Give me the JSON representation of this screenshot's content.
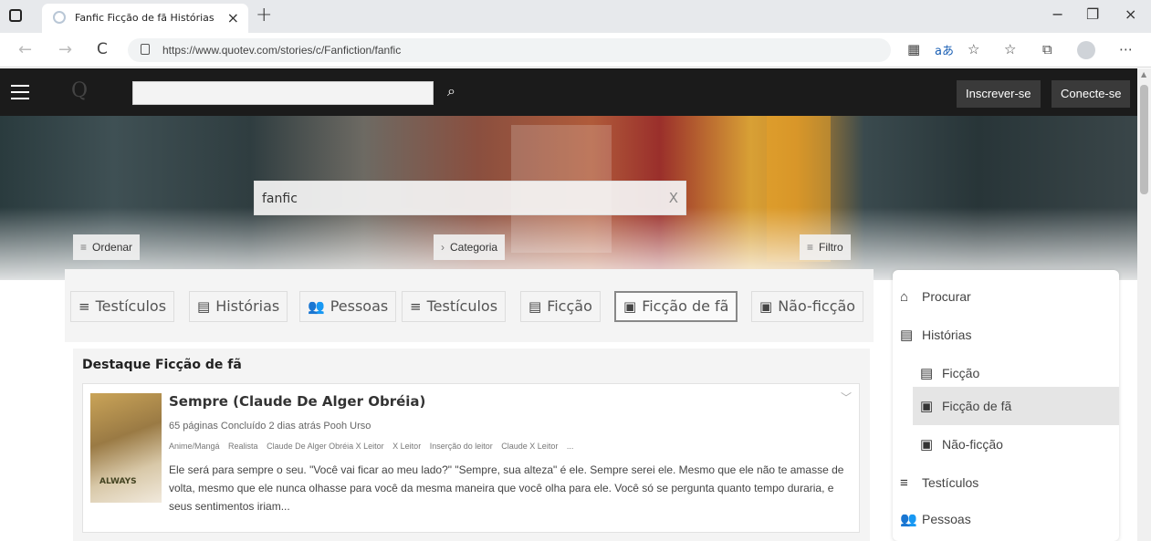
{
  "browser": {
    "tab_title": "Fanfic Ficção de fã Histórias",
    "tab_close": "×",
    "new_tab": "+",
    "url": "https://www.quotev.com/stories/c/Fanfiction/fanfic",
    "window_controls": {
      "minimize": "−",
      "restore": "❐",
      "close": "×"
    },
    "nav": {
      "back": "←",
      "forward": "→",
      "refresh": "C"
    }
  },
  "site": {
    "logo": "Q",
    "search_placeholder": "",
    "search_glyph": "⌕",
    "signup_label": "Inscrever-se",
    "login_label": "Conecte-se"
  },
  "hero": {
    "query": "fanfic",
    "clear": "X",
    "sort_label": "Ordenar",
    "category_label": "Categoria",
    "filter_label": "Filtro"
  },
  "tabs": [
    {
      "label": "Testículos"
    },
    {
      "label": "Histórias"
    },
    {
      "label": "Pessoas"
    },
    {
      "label": "Testículos"
    },
    {
      "label": "Ficção"
    },
    {
      "label": "Ficção de fã",
      "active": true
    },
    {
      "label": "Não-ficção"
    }
  ],
  "featured": {
    "heading": "Destaque Ficção de fã",
    "story": {
      "title": "Sempre (Claude De Alger Obréia)",
      "cover_text": "ALWAYS",
      "meta": "65 páginas Concluído 2 dias atrás Pooh Urso",
      "tags": [
        "Anime/Mangá",
        "Realista",
        "Claude De Alger Obréia X Leitor",
        "X Leitor",
        "Inserção do leitor",
        "Claude X Leitor",
        "..."
      ],
      "description": "Ele será para sempre o seu. \"Você vai ficar ao meu lado?\" \"Sempre, sua alteza\" é ele. Sempre serei ele. Mesmo que ele não te amasse de volta, mesmo que ele nunca olhasse para você da mesma maneira que você olha para ele. Você só se pergunta quanto tempo duraria, e seus sentimentos iriam..."
    }
  },
  "side_menu": [
    {
      "label": "Procurar"
    },
    {
      "label": "Histórias"
    },
    {
      "label": "Ficção"
    },
    {
      "label": "Ficção de fã",
      "active": true
    },
    {
      "label": "Não-ficção"
    },
    {
      "label": "Testículos"
    },
    {
      "label": "Pessoas"
    }
  ]
}
